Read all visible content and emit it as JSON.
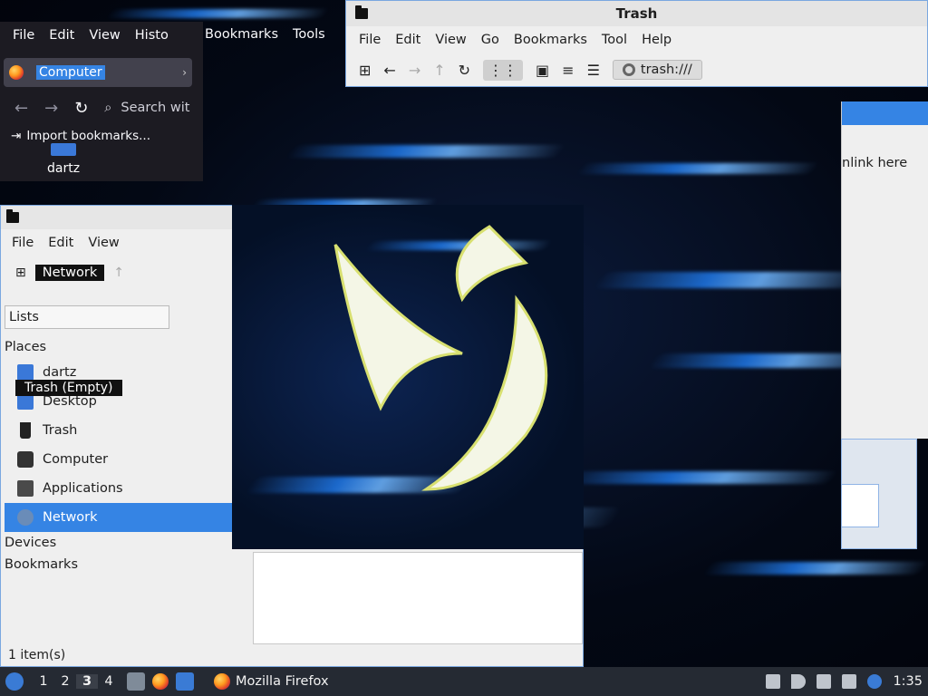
{
  "firefox": {
    "menu": [
      "File",
      "Edit",
      "View",
      "Histo",
      "Bookmarks",
      "Tools"
    ],
    "tab_title": "Computer",
    "tab_close": "›",
    "search_placeholder": "Search wit",
    "bookmark_import": "Import bookmarks..."
  },
  "desktop": {
    "icon_label": "dartz"
  },
  "trash_window": {
    "title": "Trash",
    "menu": [
      "File",
      "Edit",
      "View",
      "Go",
      "Bookmarks",
      "Tool",
      "Help"
    ],
    "path": "trash:///"
  },
  "background_window": {
    "symlink_text": "nlink here"
  },
  "network_window": {
    "menu": [
      "File",
      "Edit",
      "View"
    ],
    "location": "Network",
    "side_mode": "Lists",
    "places_header": "Places",
    "places": [
      {
        "label": "dartz",
        "icon": "home-folder-icon"
      },
      {
        "label": "Desktop",
        "icon": "desktop-icon"
      },
      {
        "label": "Trash",
        "icon": "trash-icon"
      },
      {
        "label": "Computer",
        "icon": "computer-icon"
      },
      {
        "label": "Applications",
        "icon": "applications-icon"
      },
      {
        "label": "Network",
        "icon": "network-icon"
      }
    ],
    "devices_header": "Devices",
    "bookmarks_header": "Bookmarks",
    "tooltip": "Trash (Empty)",
    "status": "1 item(s)"
  },
  "taskbar": {
    "desktops": [
      "1",
      "2",
      "3",
      "4"
    ],
    "active_desktop": "3",
    "task_label": "Mozilla Firefox",
    "clock": "1:35"
  }
}
